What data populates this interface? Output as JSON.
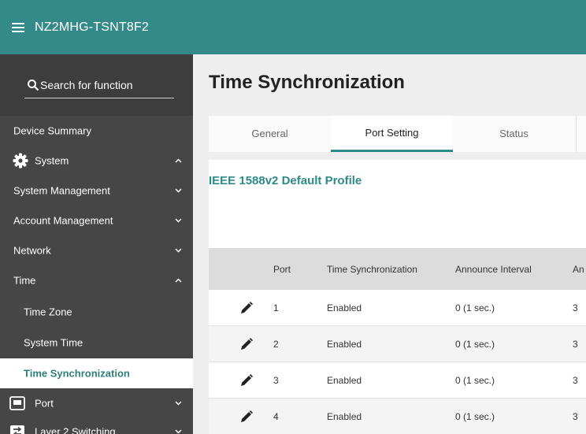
{
  "app": {
    "title": "NZ2MHG-TSNT8F2"
  },
  "search": {
    "placeholder": "Search for function"
  },
  "sidebar": {
    "items": [
      {
        "label": "Device Summary"
      },
      {
        "label": "System",
        "icon": "gear-icon",
        "expanded": true
      },
      {
        "label": "System Management",
        "expanded": false
      },
      {
        "label": "Account Management",
        "expanded": false
      },
      {
        "label": "Network",
        "expanded": false
      },
      {
        "label": "Time",
        "expanded": true
      },
      {
        "label": "Time Zone"
      },
      {
        "label": "System Time"
      },
      {
        "label": "Time Synchronization",
        "active": true
      },
      {
        "label": "Port",
        "icon": "port-icon",
        "expanded": false
      },
      {
        "label": "Layer 2 Switching",
        "icon": "switch-icon",
        "expanded": false
      }
    ]
  },
  "main": {
    "title": "Time Synchronization",
    "tabs": [
      {
        "label": "General"
      },
      {
        "label": "Port Setting",
        "active": true
      },
      {
        "label": "Status"
      }
    ],
    "profile_title": "IEEE 1588v2 Default Profile",
    "table": {
      "headers": [
        "Port",
        "Time Synchronization",
        "Announce Interval",
        "An"
      ],
      "rows": [
        {
          "port": "1",
          "sync": "Enabled",
          "announce": "0 (1 sec.)",
          "extra": "3"
        },
        {
          "port": "2",
          "sync": "Enabled",
          "announce": "0 (1 sec.)",
          "extra": "3"
        },
        {
          "port": "3",
          "sync": "Enabled",
          "announce": "0 (1 sec.)",
          "extra": "3"
        },
        {
          "port": "4",
          "sync": "Enabled",
          "announce": "0 (1 sec.)",
          "extra": "3"
        }
      ]
    }
  },
  "colors": {
    "header": "#348a88",
    "accent": "#2e8a87",
    "sidebar": "#464646"
  }
}
